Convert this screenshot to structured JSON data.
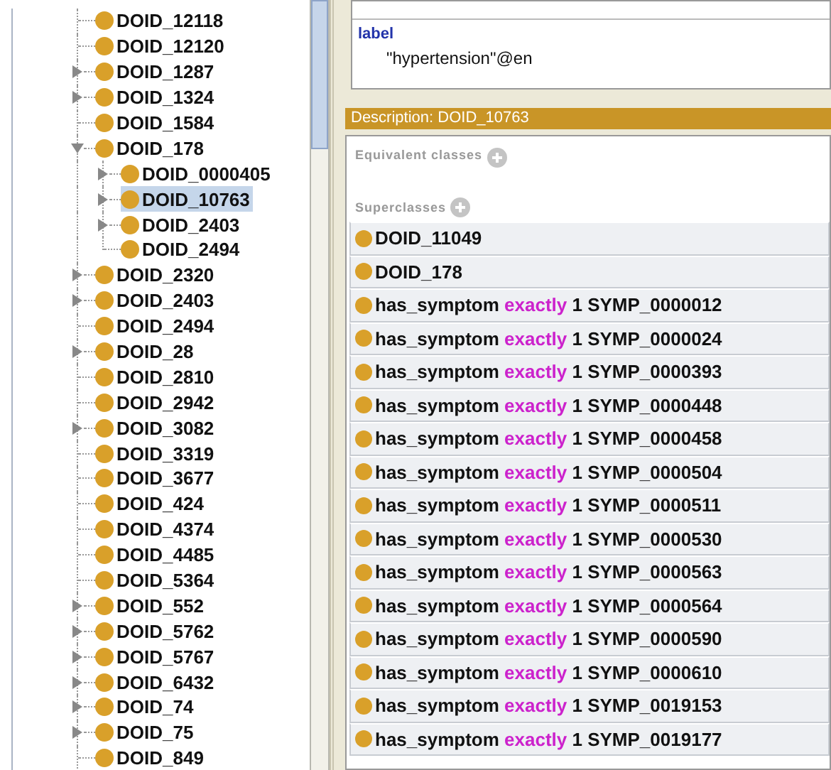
{
  "class_tree": [
    {
      "label": "DOID_12118",
      "kind": "leaf",
      "selected": false
    },
    {
      "label": "DOID_12120",
      "kind": "leaf",
      "selected": false
    },
    {
      "label": "DOID_1287",
      "kind": "collapsed",
      "selected": false
    },
    {
      "label": "DOID_1324",
      "kind": "collapsed",
      "selected": false
    },
    {
      "label": "DOID_1584",
      "kind": "leaf",
      "selected": false
    },
    {
      "label": "DOID_178",
      "kind": "expanded",
      "selected": false,
      "children": [
        {
          "label": "DOID_0000405",
          "kind": "collapsed",
          "selected": false
        },
        {
          "label": "DOID_10763",
          "kind": "collapsed",
          "selected": true
        },
        {
          "label": "DOID_2403",
          "kind": "collapsed",
          "selected": false
        },
        {
          "label": "DOID_2494",
          "kind": "leaf",
          "selected": false
        }
      ]
    },
    {
      "label": "DOID_2320",
      "kind": "collapsed",
      "selected": false
    },
    {
      "label": "DOID_2403",
      "kind": "collapsed",
      "selected": false
    },
    {
      "label": "DOID_2494",
      "kind": "leaf",
      "selected": false
    },
    {
      "label": "DOID_28",
      "kind": "collapsed",
      "selected": false
    },
    {
      "label": "DOID_2810",
      "kind": "leaf",
      "selected": false
    },
    {
      "label": "DOID_2942",
      "kind": "leaf",
      "selected": false
    },
    {
      "label": "DOID_3082",
      "kind": "collapsed",
      "selected": false
    },
    {
      "label": "DOID_3319",
      "kind": "leaf",
      "selected": false
    },
    {
      "label": "DOID_3677",
      "kind": "leaf",
      "selected": false
    },
    {
      "label": "DOID_424",
      "kind": "leaf",
      "selected": false
    },
    {
      "label": "DOID_4374",
      "kind": "leaf",
      "selected": false
    },
    {
      "label": "DOID_4485",
      "kind": "leaf",
      "selected": false
    },
    {
      "label": "DOID_5364",
      "kind": "leaf",
      "selected": false
    },
    {
      "label": "DOID_552",
      "kind": "collapsed",
      "selected": false
    },
    {
      "label": "DOID_5762",
      "kind": "collapsed",
      "selected": false
    },
    {
      "label": "DOID_5767",
      "kind": "collapsed",
      "selected": false
    },
    {
      "label": "DOID_6432",
      "kind": "collapsed",
      "selected": false
    },
    {
      "label": "DOID_74",
      "kind": "collapsed",
      "selected": false
    },
    {
      "label": "DOID_75",
      "kind": "collapsed",
      "selected": false
    },
    {
      "label": "DOID_849",
      "kind": "leaf",
      "selected": false
    }
  ],
  "annotations": [
    {
      "property": "label",
      "value": "\"hypertension\"@en"
    }
  ],
  "description": {
    "title": "Description: DOID_10763",
    "sections": [
      {
        "title": "Equivalent classes"
      },
      {
        "title": "Superclasses",
        "rows": [
          {
            "kind": "class",
            "label": "DOID_11049"
          },
          {
            "kind": "class",
            "label": "DOID_178"
          },
          {
            "kind": "restriction",
            "property": "has_symptom",
            "quantifier": "exactly",
            "cardinality": "1",
            "filler": "SYMP_0000012"
          },
          {
            "kind": "restriction",
            "property": "has_symptom",
            "quantifier": "exactly",
            "cardinality": "1",
            "filler": "SYMP_0000024"
          },
          {
            "kind": "restriction",
            "property": "has_symptom",
            "quantifier": "exactly",
            "cardinality": "1",
            "filler": "SYMP_0000393"
          },
          {
            "kind": "restriction",
            "property": "has_symptom",
            "quantifier": "exactly",
            "cardinality": "1",
            "filler": "SYMP_0000448"
          },
          {
            "kind": "restriction",
            "property": "has_symptom",
            "quantifier": "exactly",
            "cardinality": "1",
            "filler": "SYMP_0000458"
          },
          {
            "kind": "restriction",
            "property": "has_symptom",
            "quantifier": "exactly",
            "cardinality": "1",
            "filler": "SYMP_0000504"
          },
          {
            "kind": "restriction",
            "property": "has_symptom",
            "quantifier": "exactly",
            "cardinality": "1",
            "filler": "SYMP_0000511"
          },
          {
            "kind": "restriction",
            "property": "has_symptom",
            "quantifier": "exactly",
            "cardinality": "1",
            "filler": "SYMP_0000530"
          },
          {
            "kind": "restriction",
            "property": "has_symptom",
            "quantifier": "exactly",
            "cardinality": "1",
            "filler": "SYMP_0000563"
          },
          {
            "kind": "restriction",
            "property": "has_symptom",
            "quantifier": "exactly",
            "cardinality": "1",
            "filler": "SYMP_0000564"
          },
          {
            "kind": "restriction",
            "property": "has_symptom",
            "quantifier": "exactly",
            "cardinality": "1",
            "filler": "SYMP_0000590"
          },
          {
            "kind": "restriction",
            "property": "has_symptom",
            "quantifier": "exactly",
            "cardinality": "1",
            "filler": "SYMP_0000610"
          },
          {
            "kind": "restriction",
            "property": "has_symptom",
            "quantifier": "exactly",
            "cardinality": "1",
            "filler": "SYMP_0019153"
          },
          {
            "kind": "restriction",
            "property": "has_symptom",
            "quantifier": "exactly",
            "cardinality": "1",
            "filler": "SYMP_0019177"
          }
        ]
      }
    ]
  }
}
